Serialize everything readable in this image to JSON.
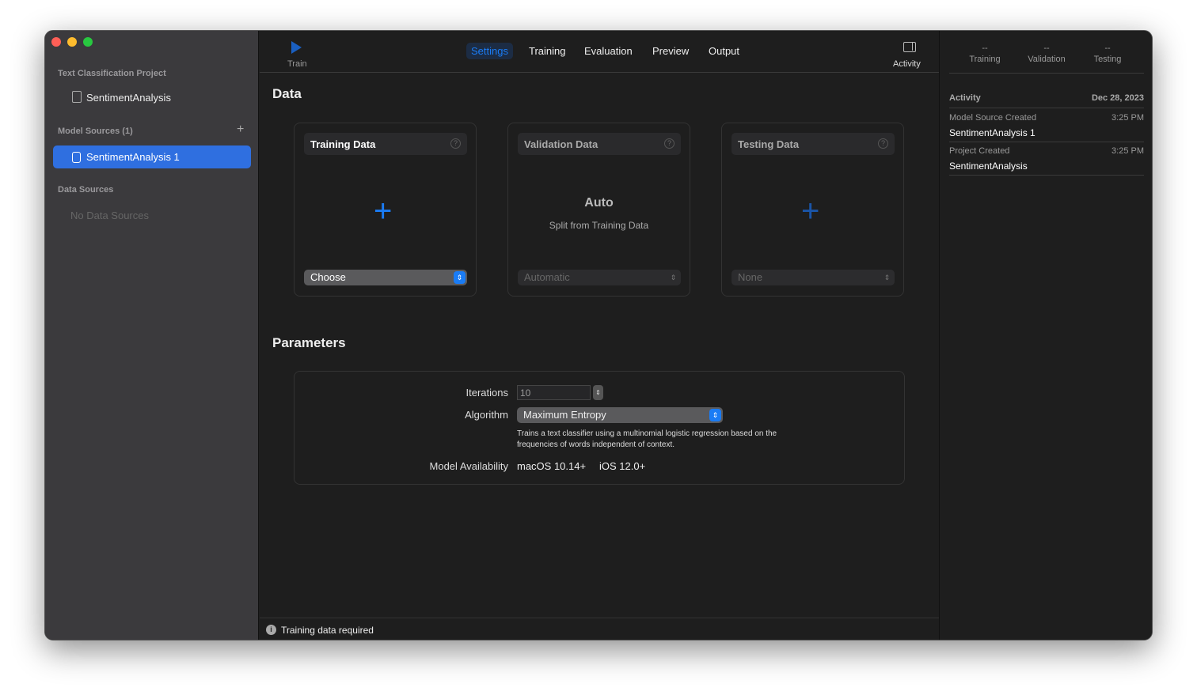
{
  "sidebar": {
    "project_section": "Text Classification Project",
    "project_item": "SentimentAnalysis",
    "model_sources_section": "Model Sources (1)",
    "model_source_item": "SentimentAnalysis 1",
    "data_sources_section": "Data Sources",
    "data_sources_empty": "No Data Sources",
    "add_icon": "plus-icon"
  },
  "toolbar": {
    "train_label": "Train",
    "tabs": [
      "Settings",
      "Training",
      "Evaluation",
      "Preview",
      "Output"
    ],
    "activity_label": "Activity",
    "accent": "#1a7cf5"
  },
  "data": {
    "title": "Data",
    "training": {
      "title": "Training Data",
      "select": "Choose"
    },
    "validation": {
      "title": "Validation Data",
      "auto": "Auto",
      "split": "Split from Training Data",
      "select": "Automatic"
    },
    "testing": {
      "title": "Testing Data",
      "select": "None"
    }
  },
  "parameters": {
    "title": "Parameters",
    "iterations_label": "Iterations",
    "iterations_value": "10",
    "algorithm_label": "Algorithm",
    "algorithm_value": "Maximum Entropy",
    "description_line1": "Trains a text classifier using a multinomial logistic regression based on the",
    "description_line2": "frequencies of words independent of context.",
    "availability_label": "Model Availability",
    "macos": "macOS 10.14+",
    "ios": "iOS 12.0+"
  },
  "status": {
    "message": "Training data required"
  },
  "metrics": [
    {
      "value": "--",
      "label": "Training"
    },
    {
      "value": "--",
      "label": "Validation"
    },
    {
      "value": "--",
      "label": "Testing"
    }
  ],
  "activity": {
    "title": "Activity",
    "date": "Dec 28, 2023",
    "entries": [
      {
        "event": "Model Source Created",
        "time": "3:25 PM",
        "name": "SentimentAnalysis 1"
      },
      {
        "event": "Project Created",
        "time": "3:25 PM",
        "name": "SentimentAnalysis"
      }
    ]
  }
}
